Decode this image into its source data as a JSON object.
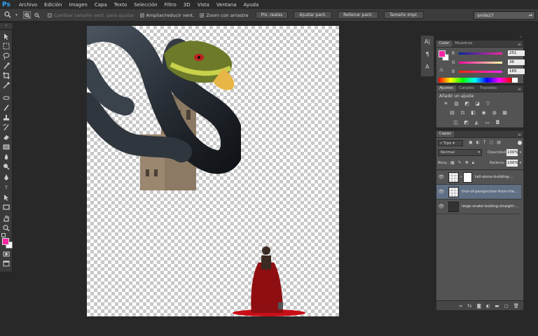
{
  "app": {
    "logo": "Ps"
  },
  "menu": [
    "Archivo",
    "Edición",
    "Imagen",
    "Capa",
    "Texto",
    "Selección",
    "Filtro",
    "3D",
    "Vista",
    "Ventana",
    "Ayuda"
  ],
  "options": {
    "resize_windows": "Cambiar tamaño vent. para ajustar",
    "zoom_all": "Ampliar/reducir vent.",
    "scrubby_zoom": "Zoom con arrastre",
    "btn_actual": "Píx. reales",
    "btn_fit": "Ajustar pant.",
    "btn_fill": "Rellenar pant.",
    "btn_print": "Tamaño impr.",
    "workspace": "smile27"
  },
  "color_panel": {
    "tabs": [
      "Color",
      "Muestras"
    ],
    "r_label": "R",
    "g_label": "G",
    "b_label": "B",
    "r": "251",
    "g": "36",
    "b": "165",
    "fg_color": "#fb24a5",
    "bg_color": "#ffffff"
  },
  "adjust_panel": {
    "tabs": [
      "Ajustes",
      "Canales",
      "Trazados"
    ],
    "heading": "Añadir un ajuste"
  },
  "layers_panel": {
    "title": "Capas",
    "filter": "Tipo",
    "blend_mode": "Normal",
    "opacity_label": "Opacidad:",
    "opacity": "100%",
    "lock_label": "Bloq.:",
    "fill_label": "Relleno:",
    "fill": "100%",
    "layers": [
      {
        "name": "tall-stone-building-..."
      },
      {
        "name": "thor-of-perspective-from-the..."
      },
      {
        "name": "large-snake-looking-straight-..."
      }
    ]
  }
}
